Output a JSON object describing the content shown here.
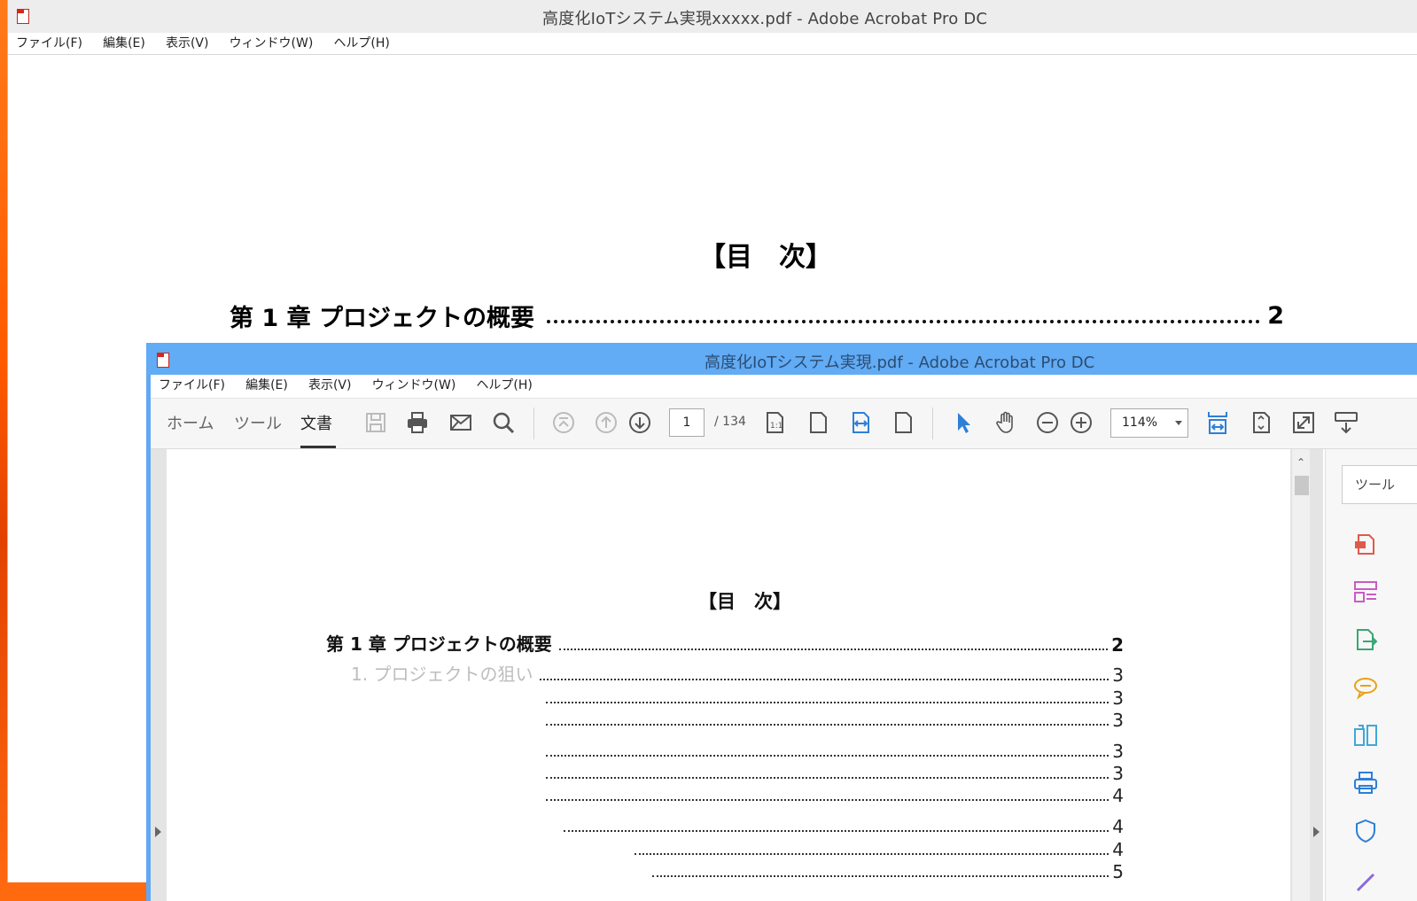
{
  "back_window": {
    "title": "高度化IoTシステム実現xxxxx.pdf - Adobe Acrobat Pro DC",
    "menu": [
      "ファイル(F)",
      "編集(E)",
      "表示(V)",
      "ウィンドウ(W)",
      "ヘルプ(H)"
    ],
    "toc_title": "【目　次】",
    "chapter_label": "第 1 章  プロジェクトの概要",
    "chapter_page": "2"
  },
  "front_window": {
    "title": "高度化IoTシステム実現.pdf - Adobe Acrobat Pro DC",
    "menu": [
      "ファイル(F)",
      "編集(E)",
      "表示(V)",
      "ウィンドウ(W)",
      "ヘルプ(H)"
    ],
    "tabs": {
      "home": "ホーム",
      "tools": "ツール",
      "document": "文書"
    },
    "page_current": "1",
    "page_total": "/ 134",
    "zoom": "114%",
    "panel_search_placeholder": "ツール",
    "toc": {
      "title": "【目　次】",
      "rows": [
        {
          "label": "第 1 章  プロジェクトの概要",
          "page": "2",
          "chapter": true
        },
        {
          "label": "1. プロジェクトの狙い",
          "page": "3"
        },
        {
          "label": "",
          "page": "3"
        },
        {
          "label": "",
          "page": "3"
        },
        {
          "label": "",
          "page": "3"
        },
        {
          "label": "",
          "page": "3"
        },
        {
          "label": "",
          "page": "4"
        },
        {
          "label": "",
          "page": "4"
        },
        {
          "label": "",
          "page": "4"
        },
        {
          "label": "",
          "page": "5"
        }
      ]
    }
  },
  "colors": {
    "front_titlebar": "#62abf5",
    "accent_blue": "#2d7fd8",
    "desktop_orange": "#ff6a0e"
  },
  "icons": [
    "pdf-app-icon",
    "save-icon",
    "print-icon",
    "email-icon",
    "search-icon",
    "first-page-icon",
    "prev-page-icon",
    "next-page-icon",
    "actual-size-icon",
    "fit-page-icon",
    "fit-width-icon",
    "single-page-icon",
    "select-cursor-icon",
    "hand-tool-icon",
    "zoom-out-icon",
    "zoom-in-icon",
    "fit-width-view-icon",
    "fit-window-icon",
    "full-screen-icon",
    "keyboard-icon",
    "export-pdf-icon",
    "organize-pages-icon",
    "edit-pdf-icon",
    "comment-icon",
    "compare-icon",
    "scan-icon",
    "protect-icon",
    "pen-icon"
  ]
}
